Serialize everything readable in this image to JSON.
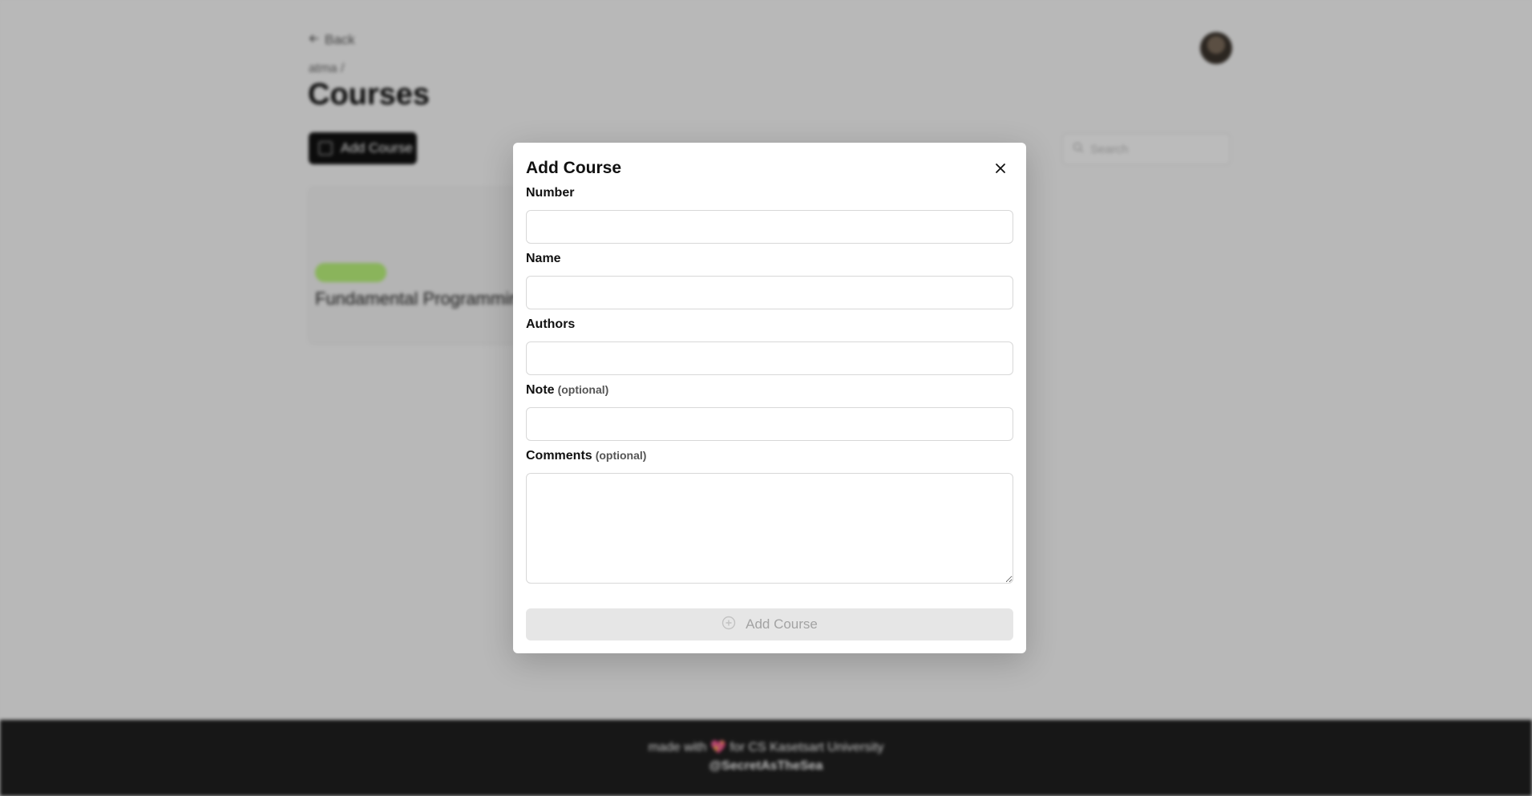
{
  "background": {
    "back_link": "Back",
    "breadcrumb": "atma /",
    "page_title": "Courses",
    "add_course_button": "Add Course",
    "search_placeholder": "Search",
    "course_card": {
      "badge": "",
      "name": "Fundamental Programming"
    },
    "footer": {
      "line1_prefix": "made with",
      "heart": "💖",
      "line1_suffix": "for CS Kasetsart University",
      "line2": "@SecretAsTheSea"
    }
  },
  "modal": {
    "title": "Add Course",
    "close_icon": "close-icon",
    "optional_tag": "(optional)",
    "fields": {
      "number": {
        "label": "Number",
        "value": "",
        "placeholder": ""
      },
      "name": {
        "label": "Name",
        "value": "",
        "placeholder": ""
      },
      "authors": {
        "label": "Authors",
        "value": "",
        "placeholder": ""
      },
      "note": {
        "label": "Note",
        "value": "",
        "placeholder": ""
      },
      "comments": {
        "label": "Comments",
        "value": "",
        "placeholder": ""
      }
    },
    "submit": {
      "label": "Add Course",
      "icon": "plus-circle-icon",
      "disabled": true
    }
  }
}
